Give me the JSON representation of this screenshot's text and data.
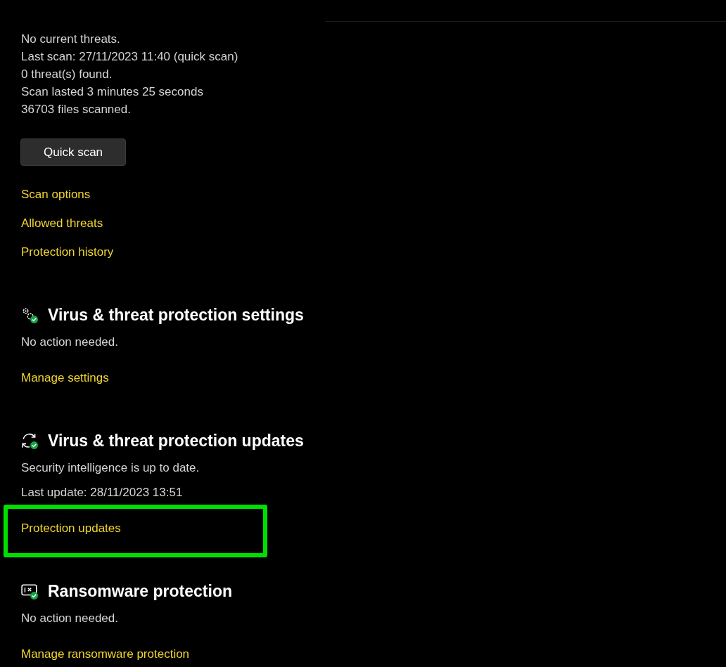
{
  "scan_status": {
    "lines": [
      "No current threats.",
      "Last scan: 27/11/2023 11:40 (quick scan)",
      "0 threat(s) found.",
      "Scan lasted 3 minutes 25 seconds",
      "36703 files scanned."
    ],
    "button": "Quick scan",
    "links": [
      "Scan options",
      "Allowed threats",
      "Protection history"
    ]
  },
  "sections": [
    {
      "kind": "settings",
      "title": "Virus & threat protection settings",
      "lines": [
        "No action needed."
      ],
      "links": [
        {
          "label": "Manage settings",
          "highlighted": false
        }
      ]
    },
    {
      "kind": "updates",
      "title": "Virus & threat protection updates",
      "lines": [
        "Security intelligence is up to date.",
        "Last update: 28/11/2023 13:51"
      ],
      "links": [
        {
          "label": "Protection updates",
          "highlighted": true
        }
      ]
    },
    {
      "kind": "ransomware",
      "title": "Ransomware protection",
      "lines": [
        "No action needed."
      ],
      "links": [
        {
          "label": "Manage ransomware protection",
          "highlighted": false
        }
      ]
    }
  ]
}
